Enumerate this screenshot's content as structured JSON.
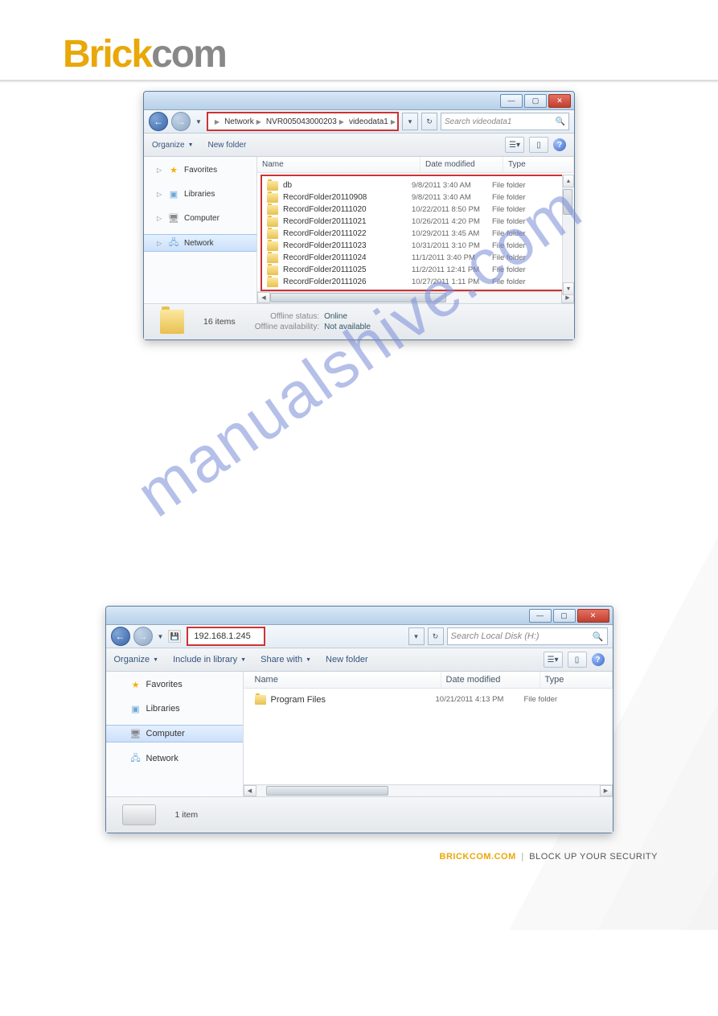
{
  "header": {
    "brand1": "Brick",
    "brand2": "com"
  },
  "watermark": "manualshive.com",
  "footer": {
    "brickcom": "BRICKCOM.COM",
    "divider": "|",
    "tagline": "BLOCK UP YOUR SECURITY"
  },
  "win1": {
    "breadcrumb": [
      "Network",
      "NVR005043000203",
      "videodata1"
    ],
    "search_placeholder": "Search videodata1",
    "toolbar": {
      "organize": "Organize",
      "newfolder": "New folder"
    },
    "sidebar": {
      "favorites": "Favorites",
      "libraries": "Libraries",
      "computer": "Computer",
      "network": "Network"
    },
    "cols": {
      "name": "Name",
      "date": "Date modified",
      "type": "Type"
    },
    "files": [
      {
        "name": "db",
        "date": "9/8/2011 3:40 AM",
        "type": "File folder"
      },
      {
        "name": "RecordFolder20110908",
        "date": "9/8/2011 3:40 AM",
        "type": "File folder"
      },
      {
        "name": "RecordFolder20111020",
        "date": "10/22/2011 8:50 PM",
        "type": "File folder"
      },
      {
        "name": "RecordFolder20111021",
        "date": "10/26/2011 4:20 PM",
        "type": "File folder"
      },
      {
        "name": "RecordFolder20111022",
        "date": "10/29/2011 3:45 AM",
        "type": "File folder"
      },
      {
        "name": "RecordFolder20111023",
        "date": "10/31/2011 3:10 PM",
        "type": "File folder"
      },
      {
        "name": "RecordFolder20111024",
        "date": "11/1/2011 3:40 PM",
        "type": "File folder"
      },
      {
        "name": "RecordFolder20111025",
        "date": "11/2/2011 12:41 PM",
        "type": "File folder"
      },
      {
        "name": "RecordFolder20111026",
        "date": "10/27/2011 1:11 PM",
        "type": "File folder"
      }
    ],
    "status": {
      "count": "16 items",
      "offline_status_l": "Offline status:",
      "offline_status_v": "Online",
      "offline_avail_l": "Offline availability:",
      "offline_avail_v": "Not available"
    }
  },
  "win2": {
    "address": "192.168.1.245",
    "search_placeholder": "Search Local Disk (H:)",
    "toolbar": {
      "organize": "Organize",
      "include": "Include in library",
      "share": "Share with",
      "newfolder": "New folder"
    },
    "sidebar": {
      "favorites": "Favorites",
      "libraries": "Libraries",
      "computer": "Computer",
      "network": "Network"
    },
    "cols": {
      "name": "Name",
      "date": "Date modified",
      "type": "Type"
    },
    "files": [
      {
        "name": "Program Files",
        "date": "10/21/2011 4:13 PM",
        "type": "File folder"
      }
    ],
    "status": {
      "count": "1 item"
    }
  }
}
